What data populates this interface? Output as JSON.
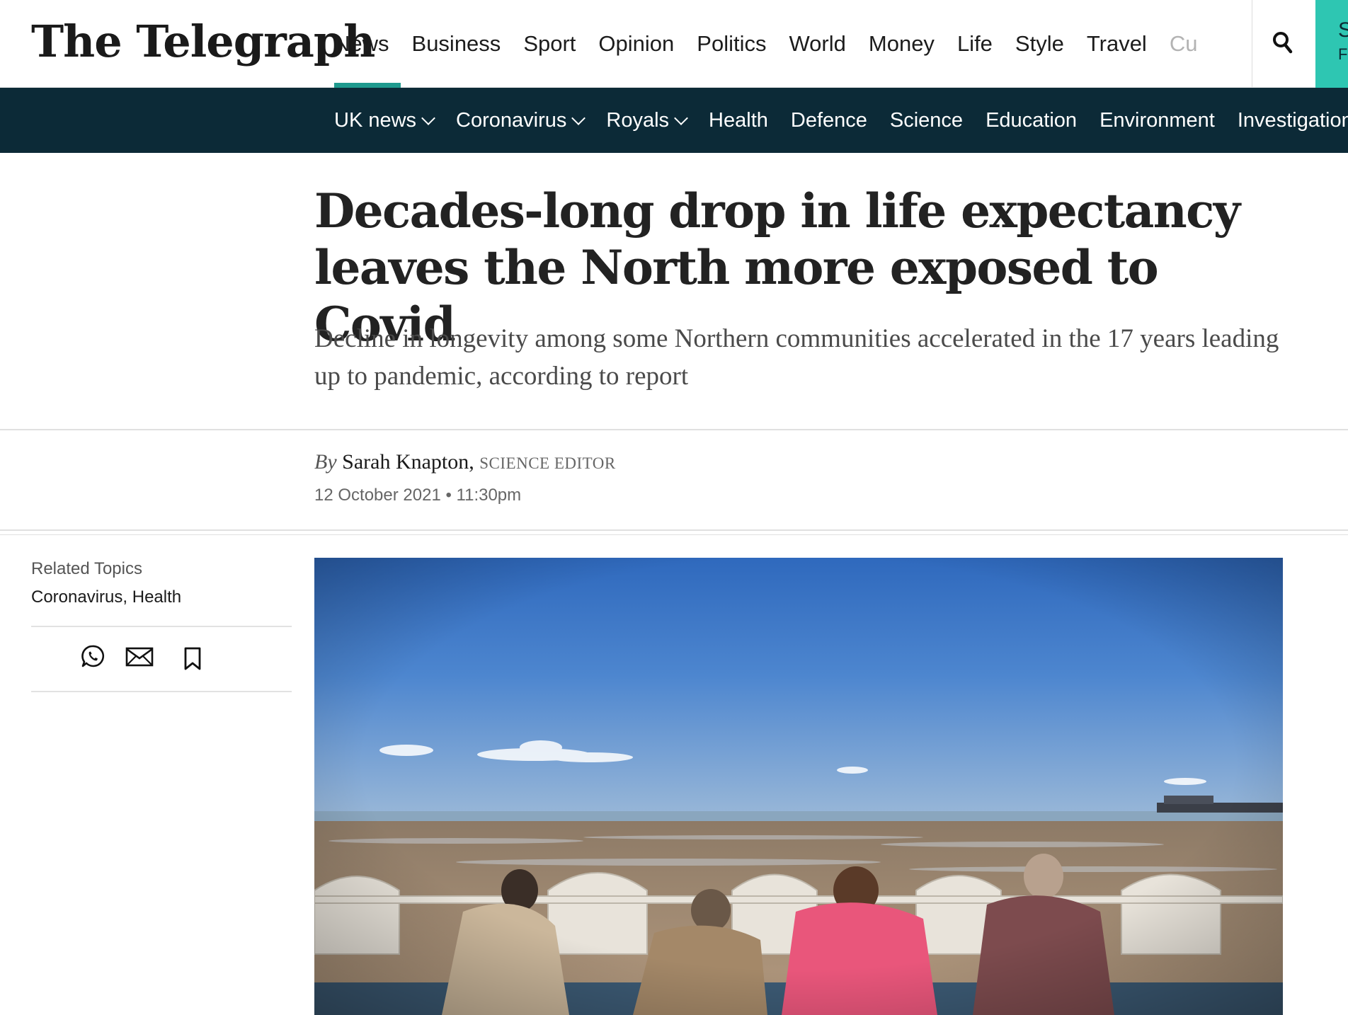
{
  "header": {
    "logo": "The Telegraph",
    "nav": [
      "News",
      "Business",
      "Sport",
      "Opinion",
      "Politics",
      "World",
      "Money",
      "Life",
      "Style",
      "Travel",
      "Cu"
    ],
    "active_nav": "News",
    "search_icon": "search-icon",
    "subscribe_line1": "S",
    "subscribe_line2": "F"
  },
  "subnav": {
    "items": [
      {
        "label": "UK news",
        "dropdown": true
      },
      {
        "label": "Coronavirus",
        "dropdown": true
      },
      {
        "label": "Royals",
        "dropdown": true
      },
      {
        "label": "Health",
        "dropdown": false
      },
      {
        "label": "Defence",
        "dropdown": false
      },
      {
        "label": "Science",
        "dropdown": false
      },
      {
        "label": "Education",
        "dropdown": false
      },
      {
        "label": "Environment",
        "dropdown": false
      },
      {
        "label": "Investigation",
        "dropdown": false
      }
    ]
  },
  "article": {
    "headline": "Decades-long drop in life expectancy leaves the North more exposed to Covid",
    "standfirst": "Decline in longevity among some Northern communities accelerated in the 17 years leading up to pandemic, according to report",
    "byline_prefix": "By",
    "author": "Sarah Knapton,",
    "author_role": "SCIENCE EDITOR",
    "date": "12 October 2021 • 11:30pm"
  },
  "sidebar": {
    "related_title": "Related Topics",
    "related_topic_1": "Coronavirus",
    "related_sep": ", ",
    "related_topic_2": "Health",
    "share_icons": [
      "whatsapp-icon",
      "email-icon",
      "bookmark-icon"
    ]
  },
  "colors": {
    "accent": "#1f9a8e",
    "subnav_bg": "#0c2a37",
    "subscribe_bg": "#2ec6b2"
  }
}
